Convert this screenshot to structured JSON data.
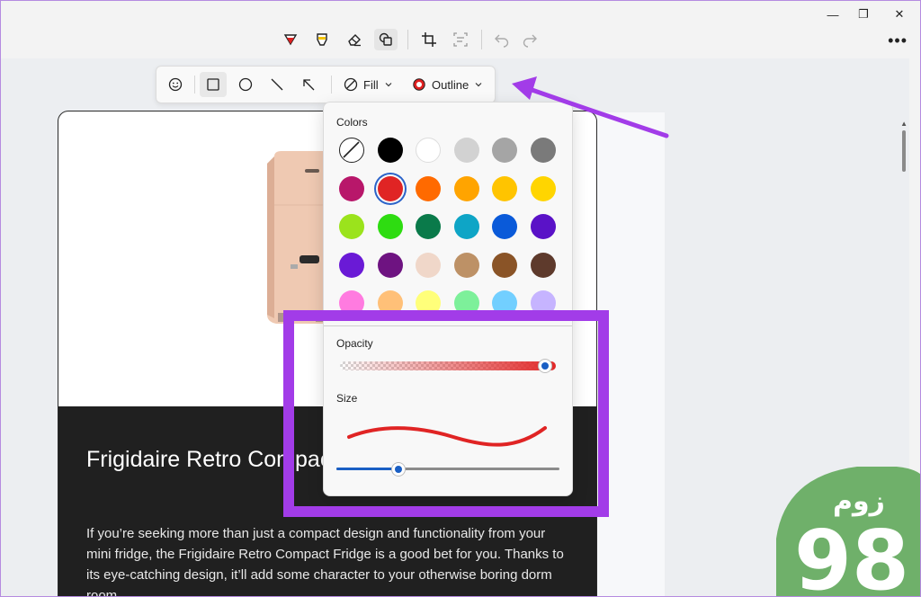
{
  "window": {
    "controls": {
      "minimize": "—",
      "maximize": "❐",
      "close": "✕"
    },
    "more_label": "•••"
  },
  "toolbar": {
    "tools": [
      {
        "name": "ballpoint-pen",
        "icon": "pen-icon",
        "color": "#e02020"
      },
      {
        "name": "highlighter",
        "icon": "highlighter-icon",
        "color": "#f2c200"
      },
      {
        "name": "eraser",
        "icon": "eraser-icon"
      },
      {
        "name": "shapes",
        "icon": "shapes-icon",
        "active": true
      },
      {
        "name": "crop",
        "icon": "crop-icon"
      },
      {
        "name": "text-actions",
        "icon": "text-scan-icon"
      },
      {
        "name": "undo",
        "icon": "undo-icon"
      },
      {
        "name": "redo",
        "icon": "redo-icon"
      }
    ]
  },
  "shape_bar": {
    "shapes": [
      "emoji-icon",
      "rectangle-icon",
      "ellipse-icon",
      "line-icon",
      "arrow-icon"
    ],
    "selected_shape": "rectangle-icon",
    "fill_label": "Fill",
    "outline_label": "Outline",
    "outline_color": "#e02020"
  },
  "popup": {
    "colors_label": "Colors",
    "colors": [
      [
        "none",
        "#000000",
        "#ffffff",
        "#d2d2d2",
        "#a5a5a5",
        "#7a7a7a"
      ],
      [
        "#b8176a",
        "#e02424",
        "#ff6a00",
        "#ffa400",
        "#ffc400",
        "#ffd500"
      ],
      [
        "#9be31c",
        "#2edc11",
        "#0a7a4a",
        "#0ea5c6",
        "#0a5ad9",
        "#5a12c7"
      ],
      [
        "#6a1ad6",
        "#6e1381",
        "#f0d7c9",
        "#bd9166",
        "#8a5427",
        "#5e3a2c"
      ],
      [
        "#ff7be0",
        "#ffc078",
        "#ffff7a",
        "#7df09a",
        "#72cfff",
        "#c6b4ff"
      ]
    ],
    "selected_color": "#e02424",
    "opacity_label": "Opacity",
    "opacity_value": 0.95,
    "size_label": "Size",
    "size_value": 0.28,
    "size_preview_color": "#e02424"
  },
  "page": {
    "title": "Frigidaire Retro Compact Fridge",
    "body": "If you’re seeking more than just a compact design and functionality from your mini fridge, the Frigidaire Retro Compact Fridge is a good bet for you. Thanks to its eye-catching design, it’ll add some character to your otherwise boring dorm room.",
    "image": "retro-fridge-image"
  },
  "annotations": {
    "highlight_color": "#a23ce8",
    "arrow_color": "#a23ce8"
  },
  "logo": {
    "text_arabic": "زوم",
    "text_number": "98",
    "bg_color": "#6fb06a"
  }
}
